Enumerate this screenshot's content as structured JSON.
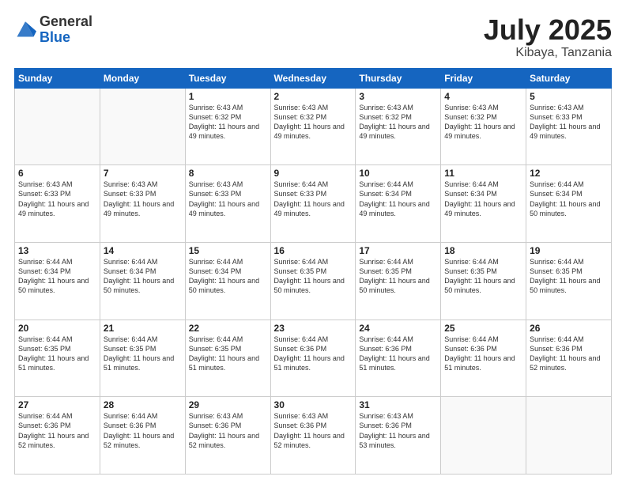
{
  "logo": {
    "general": "General",
    "blue": "Blue"
  },
  "title": {
    "month": "July 2025",
    "location": "Kibaya, Tanzania"
  },
  "weekdays": [
    "Sunday",
    "Monday",
    "Tuesday",
    "Wednesday",
    "Thursday",
    "Friday",
    "Saturday"
  ],
  "weeks": [
    [
      {
        "day": "",
        "info": ""
      },
      {
        "day": "",
        "info": ""
      },
      {
        "day": "1",
        "info": "Sunrise: 6:43 AM\nSunset: 6:32 PM\nDaylight: 11 hours and 49 minutes."
      },
      {
        "day": "2",
        "info": "Sunrise: 6:43 AM\nSunset: 6:32 PM\nDaylight: 11 hours and 49 minutes."
      },
      {
        "day": "3",
        "info": "Sunrise: 6:43 AM\nSunset: 6:32 PM\nDaylight: 11 hours and 49 minutes."
      },
      {
        "day": "4",
        "info": "Sunrise: 6:43 AM\nSunset: 6:32 PM\nDaylight: 11 hours and 49 minutes."
      },
      {
        "day": "5",
        "info": "Sunrise: 6:43 AM\nSunset: 6:33 PM\nDaylight: 11 hours and 49 minutes."
      }
    ],
    [
      {
        "day": "6",
        "info": "Sunrise: 6:43 AM\nSunset: 6:33 PM\nDaylight: 11 hours and 49 minutes."
      },
      {
        "day": "7",
        "info": "Sunrise: 6:43 AM\nSunset: 6:33 PM\nDaylight: 11 hours and 49 minutes."
      },
      {
        "day": "8",
        "info": "Sunrise: 6:43 AM\nSunset: 6:33 PM\nDaylight: 11 hours and 49 minutes."
      },
      {
        "day": "9",
        "info": "Sunrise: 6:44 AM\nSunset: 6:33 PM\nDaylight: 11 hours and 49 minutes."
      },
      {
        "day": "10",
        "info": "Sunrise: 6:44 AM\nSunset: 6:34 PM\nDaylight: 11 hours and 49 minutes."
      },
      {
        "day": "11",
        "info": "Sunrise: 6:44 AM\nSunset: 6:34 PM\nDaylight: 11 hours and 49 minutes."
      },
      {
        "day": "12",
        "info": "Sunrise: 6:44 AM\nSunset: 6:34 PM\nDaylight: 11 hours and 50 minutes."
      }
    ],
    [
      {
        "day": "13",
        "info": "Sunrise: 6:44 AM\nSunset: 6:34 PM\nDaylight: 11 hours and 50 minutes."
      },
      {
        "day": "14",
        "info": "Sunrise: 6:44 AM\nSunset: 6:34 PM\nDaylight: 11 hours and 50 minutes."
      },
      {
        "day": "15",
        "info": "Sunrise: 6:44 AM\nSunset: 6:34 PM\nDaylight: 11 hours and 50 minutes."
      },
      {
        "day": "16",
        "info": "Sunrise: 6:44 AM\nSunset: 6:35 PM\nDaylight: 11 hours and 50 minutes."
      },
      {
        "day": "17",
        "info": "Sunrise: 6:44 AM\nSunset: 6:35 PM\nDaylight: 11 hours and 50 minutes."
      },
      {
        "day": "18",
        "info": "Sunrise: 6:44 AM\nSunset: 6:35 PM\nDaylight: 11 hours and 50 minutes."
      },
      {
        "day": "19",
        "info": "Sunrise: 6:44 AM\nSunset: 6:35 PM\nDaylight: 11 hours and 50 minutes."
      }
    ],
    [
      {
        "day": "20",
        "info": "Sunrise: 6:44 AM\nSunset: 6:35 PM\nDaylight: 11 hours and 51 minutes."
      },
      {
        "day": "21",
        "info": "Sunrise: 6:44 AM\nSunset: 6:35 PM\nDaylight: 11 hours and 51 minutes."
      },
      {
        "day": "22",
        "info": "Sunrise: 6:44 AM\nSunset: 6:35 PM\nDaylight: 11 hours and 51 minutes."
      },
      {
        "day": "23",
        "info": "Sunrise: 6:44 AM\nSunset: 6:36 PM\nDaylight: 11 hours and 51 minutes."
      },
      {
        "day": "24",
        "info": "Sunrise: 6:44 AM\nSunset: 6:36 PM\nDaylight: 11 hours and 51 minutes."
      },
      {
        "day": "25",
        "info": "Sunrise: 6:44 AM\nSunset: 6:36 PM\nDaylight: 11 hours and 51 minutes."
      },
      {
        "day": "26",
        "info": "Sunrise: 6:44 AM\nSunset: 6:36 PM\nDaylight: 11 hours and 52 minutes."
      }
    ],
    [
      {
        "day": "27",
        "info": "Sunrise: 6:44 AM\nSunset: 6:36 PM\nDaylight: 11 hours and 52 minutes."
      },
      {
        "day": "28",
        "info": "Sunrise: 6:44 AM\nSunset: 6:36 PM\nDaylight: 11 hours and 52 minutes."
      },
      {
        "day": "29",
        "info": "Sunrise: 6:43 AM\nSunset: 6:36 PM\nDaylight: 11 hours and 52 minutes."
      },
      {
        "day": "30",
        "info": "Sunrise: 6:43 AM\nSunset: 6:36 PM\nDaylight: 11 hours and 52 minutes."
      },
      {
        "day": "31",
        "info": "Sunrise: 6:43 AM\nSunset: 6:36 PM\nDaylight: 11 hours and 53 minutes."
      },
      {
        "day": "",
        "info": ""
      },
      {
        "day": "",
        "info": ""
      }
    ]
  ]
}
